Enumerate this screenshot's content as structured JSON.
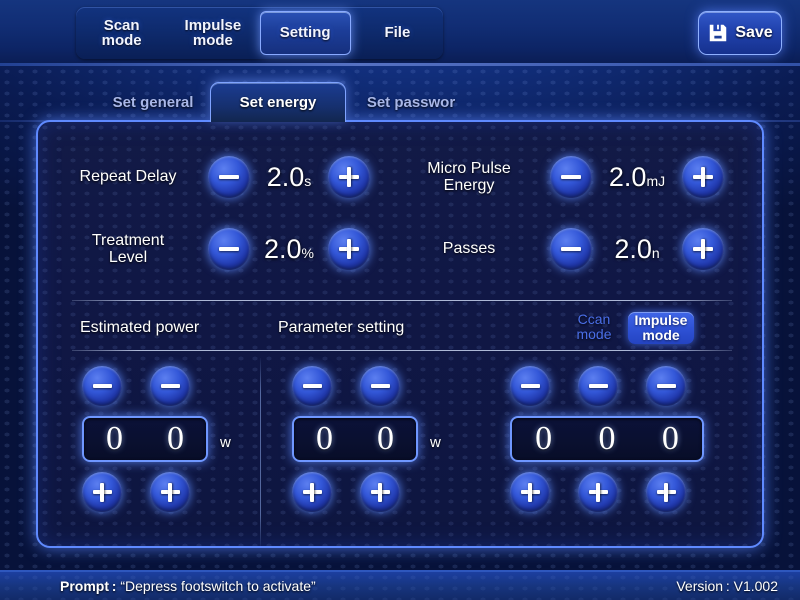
{
  "topnav": {
    "items": [
      {
        "label": "Scan\nmode",
        "active": false
      },
      {
        "label": "Impulse\nmode",
        "active": false
      },
      {
        "label": "Setting",
        "active": true
      },
      {
        "label": "File",
        "active": false
      }
    ],
    "save_label": "Save",
    "save_icon": "floppy-disk-icon"
  },
  "tabs": [
    {
      "label": "Set general",
      "active": false
    },
    {
      "label": "Set energy",
      "active": true
    },
    {
      "label": "Set passwor",
      "active": false
    }
  ],
  "parameters": [
    {
      "label": "Repeat Delay",
      "value": "2.0",
      "unit": "s",
      "minus": "minus-icon",
      "plus": "plus-icon"
    },
    {
      "label": "Micro Pulse\nEnergy",
      "value": "2.0",
      "unit": "mJ",
      "minus": "minus-icon",
      "plus": "plus-icon"
    },
    {
      "label": "Treatment\nLevel",
      "value": "2.0",
      "unit": "%",
      "minus": "minus-icon",
      "plus": "plus-icon"
    },
    {
      "label": "Passes",
      "value": "2.0",
      "unit": "n",
      "minus": "minus-icon",
      "plus": "plus-icon"
    }
  ],
  "sections": {
    "estimated_power": "Estimated power",
    "parameter_setting": "Parameter setting"
  },
  "mode_toggle": {
    "scan_label": "Ccan\nmode",
    "impulse_label": "Impulse\nmode",
    "selected": "impulse",
    "selected_color": "#2f52d6",
    "unselected_color": "#4a6fe8"
  },
  "counters": [
    {
      "digits": [
        "0",
        "0"
      ],
      "unit": "w"
    },
    {
      "digits": [
        "0",
        "0"
      ],
      "unit": "w"
    },
    {
      "digits": [
        "0",
        "0",
        "0"
      ],
      "unit": ""
    }
  ],
  "statusbar": {
    "prompt_label": "Prompt :",
    "prompt_text": "“Depress footswitch to activate”",
    "version": "Version : V1.002"
  }
}
